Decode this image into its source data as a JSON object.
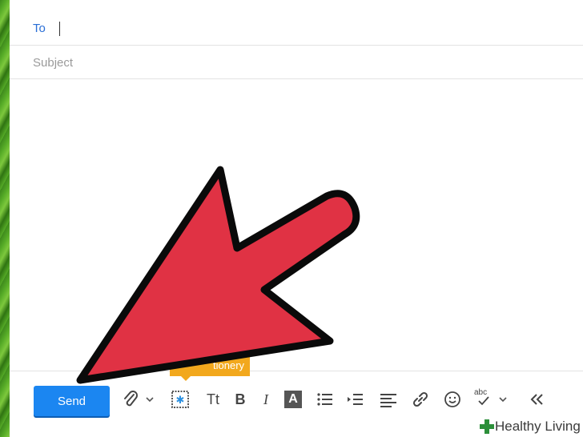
{
  "compose": {
    "to_label": "To",
    "subject_placeholder": "Subject"
  },
  "toolbar": {
    "send_label": "Send",
    "tooltip_text": "tionery",
    "font_size_glyph": "Tt",
    "bold_glyph": "B",
    "italic_glyph": "I",
    "text_color_glyph": "A",
    "spellcheck_glyph": "abc"
  },
  "watermark": {
    "brand_text": "Healthy Living"
  },
  "colors": {
    "accent": "#1b86f1",
    "tooltip": "#f2a81d",
    "arrow": "#e03244",
    "link": "#2a6fd6"
  },
  "icons": [
    "paperclip-icon",
    "chevron-down-icon",
    "stationery-icon",
    "bullet-list-icon",
    "indent-icon",
    "align-left-icon",
    "link-icon",
    "emoji-icon",
    "spellcheck-icon",
    "collapse-toolbar-icon",
    "red-arrow-icon",
    "green-cross-icon"
  ]
}
